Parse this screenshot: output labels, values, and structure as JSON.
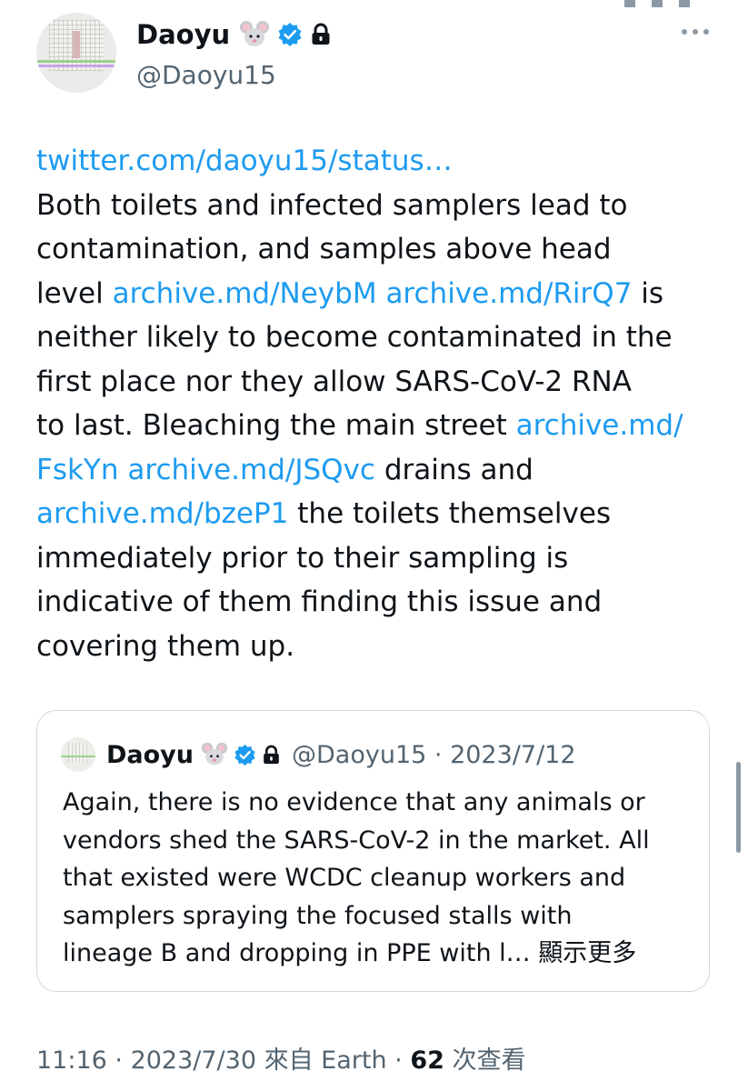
{
  "author": {
    "display_name": "Daoyu",
    "handle": "@Daoyu15",
    "badges": [
      "mouse-emoji",
      "verified-badge",
      "protected-lock"
    ]
  },
  "tweet": {
    "lines": [
      [
        {
          "t": "twitter.com/daoyu15/status…",
          "link": true
        }
      ],
      [
        {
          "t": "Both toilets and infected samplers lead to",
          "link": false
        }
      ],
      [
        {
          "t": "contamination, and samples above head",
          "link": false
        }
      ],
      [
        {
          "t": "level ",
          "link": false
        },
        {
          "t": "archive.md/NeybM",
          "link": true
        },
        {
          "t": " ",
          "link": false
        },
        {
          "t": "archive.md/RirQ7",
          "link": true
        },
        {
          "t": " is",
          "link": false
        }
      ],
      [
        {
          "t": "neither likely to become contaminated in the",
          "link": false
        }
      ],
      [
        {
          "t": "first place nor they allow SARS-CoV-2 RNA",
          "link": false
        }
      ],
      [
        {
          "t": "to last. Bleaching the main street ",
          "link": false
        },
        {
          "t": "archive.md/",
          "link": true
        }
      ],
      [
        {
          "t": "FskYn",
          "link": true
        },
        {
          "t": " ",
          "link": false
        },
        {
          "t": "archive.md/JSQvc",
          "link": true
        },
        {
          "t": " drains and",
          "link": false
        }
      ],
      [
        {
          "t": "archive.md/bzeP1",
          "link": true
        },
        {
          "t": " the toilets themselves",
          "link": false
        }
      ],
      [
        {
          "t": "immediately prior to their sampling is",
          "link": false
        }
      ],
      [
        {
          "t": "indicative of them finding this issue and",
          "link": false
        }
      ],
      [
        {
          "t": "covering them up.",
          "link": false
        }
      ]
    ]
  },
  "quote": {
    "display_name": "Daoyu",
    "handle": "@Daoyu15",
    "separator": " · ",
    "date": "2023/7/12",
    "lines": [
      "Again, there is no evidence that any animals or",
      "vendors shed the SARS-CoV-2 in the market. All",
      "that existed were WCDC cleanup workers and",
      "samplers spraying the focused stalls with",
      "lineage B and dropping in PPE with l… "
    ],
    "show_more": "顯示更多"
  },
  "footer": {
    "time": "11:16",
    "sep1": " · ",
    "date": "2023/7/30",
    "source": " 來自 Earth",
    "sep2": " · ",
    "views_count": "62",
    "views_label": " 次查看"
  },
  "colors": {
    "link": "#1d9bf0",
    "text": "#0f1419",
    "secondary": "#536471",
    "border": "#cfd9de"
  }
}
